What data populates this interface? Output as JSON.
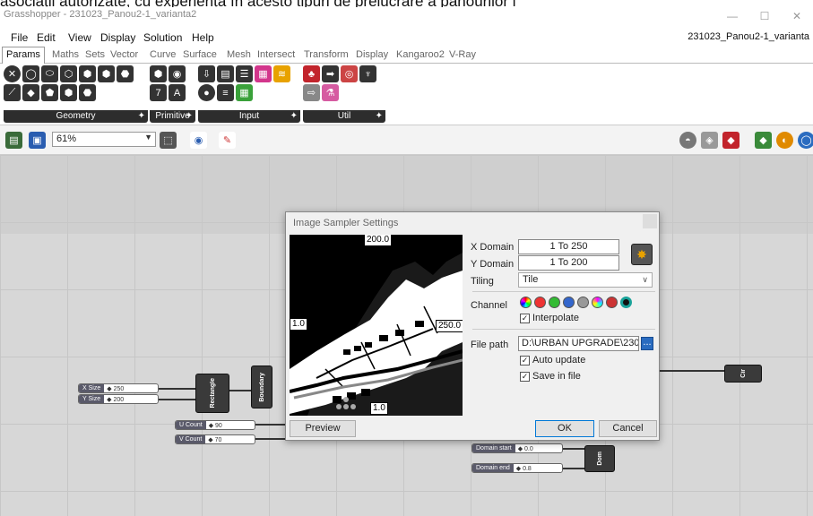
{
  "overlay_caption": "asociații autorizate, cu experiența în acesto tipuri de prelucrare a panourilor i",
  "window": {
    "app_title": "Grasshopper - 231023_Panou2-1_varianta2",
    "doc_title": "231023_Panou2-1_varianta",
    "controls": [
      "—",
      "☐",
      "✕"
    ]
  },
  "menu": [
    "File",
    "Edit",
    "View",
    "Display",
    "Solution",
    "Help"
  ],
  "tabs": [
    "Params",
    "Maths",
    "Sets",
    "Vector",
    "Curve",
    "Surface",
    "Mesh",
    "Intersect",
    "Transform",
    "Display",
    "Kangaroo2",
    "V-Ray"
  ],
  "active_tab": "Params",
  "ribbon_groups": [
    "Geometry",
    "Primitive",
    "Input",
    "Util"
  ],
  "zoom": "61%",
  "canvas": {
    "sliders": [
      {
        "label": "X Size",
        "value": "◆ 250"
      },
      {
        "label": "Y Size",
        "value": "◆ 200"
      },
      {
        "label": "U Count",
        "value": "◆ 90"
      },
      {
        "label": "V Count",
        "value": "◆ 70"
      },
      {
        "label": "Domain start",
        "value": "◆ 0.0"
      },
      {
        "label": "Domain end",
        "value": "◆ 0.8"
      }
    ],
    "components": [
      "Rectangle",
      "Boundary",
      "Dom",
      "Cir"
    ]
  },
  "dialog": {
    "title": "Image Sampler Settings",
    "preview_labels": {
      "top": "200.0",
      "left": "1.0",
      "right": "250.0",
      "bottom": "1.0"
    },
    "x_domain_label": "X Domain",
    "x_domain_value": "1 To 250",
    "y_domain_label": "Y Domain",
    "y_domain_value": "1 To 200",
    "tiling_label": "Tiling",
    "tiling_value": "Tile",
    "channel_label": "Channel",
    "interpolate_label": "Interpolate",
    "file_path_label": "File path",
    "file_path_value": "D:\\URBAN UPGRADE\\230112",
    "browse_label": "...",
    "auto_update_label": "Auto update",
    "save_in_file_label": "Save in file",
    "preview_button": "Preview",
    "ok_button": "OK",
    "cancel_button": "Cancel"
  },
  "colors": {
    "accent": "#0078d7",
    "ribbon_label_bg": "#2d2d2d",
    "canvas_bg": "#d7d7d7"
  }
}
